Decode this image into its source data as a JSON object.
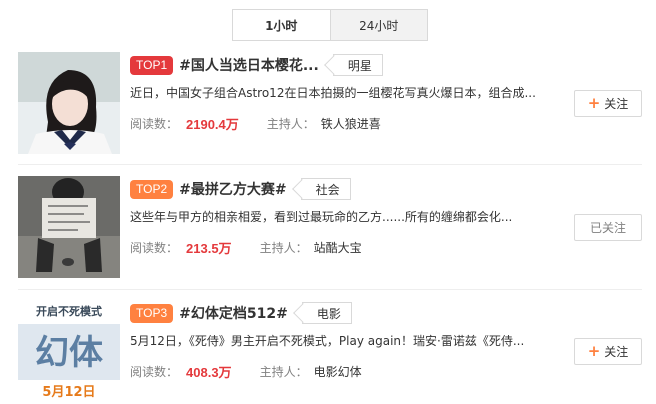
{
  "tabs": [
    {
      "label": "1小时",
      "active": true
    },
    {
      "label": "24小时",
      "active": false
    }
  ],
  "items": [
    {
      "rank": "TOP1",
      "topic": "#国人当选日本樱花...",
      "tag": "明星",
      "desc": "近日，中国女子组合Astro12在日本拍摄的一组樱花写真火爆日本，组合成...",
      "reads_label": "阅读数：",
      "reads": "2190.4万",
      "host_label": "主持人：",
      "host": "铁人狼进喜",
      "follow_label": "关注",
      "followed": false
    },
    {
      "rank": "TOP2",
      "topic": "#最拼乙方大赛#",
      "tag": "社会",
      "desc": "这些年与甲方的相亲相爱，看到过最玩命的乙方......所有的缠绵都会化...",
      "reads_label": "阅读数：",
      "reads": "213.5万",
      "host_label": "主持人：",
      "host": "站酷大宝",
      "follow_label": "已关注",
      "followed": true
    },
    {
      "rank": "TOP3",
      "topic": "#幻体定档512#",
      "tag": "电影",
      "desc": "5月12日，《死侍》男主开启不死模式，Play again！瑞安·雷诺兹《死侍...",
      "reads_label": "阅读数：",
      "reads": "408.3万",
      "host_label": "主持人：",
      "host": "电影幻体",
      "follow_label": "关注",
      "followed": false,
      "poster_texts": [
        "开启不死模式",
        "幻体",
        "5月12日"
      ]
    }
  ],
  "colors": {
    "rank1": "#e4393c",
    "rank_other": "#ff8140",
    "reads": "#e4393c",
    "plus": "#ff8140"
  }
}
